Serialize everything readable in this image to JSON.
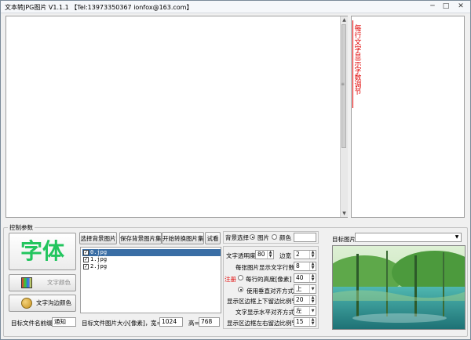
{
  "window": {
    "title": "文本转JPG图片 V1.1.1 【Tel:13973350367  ionfox@163.com】",
    "minimize_glyph": "─",
    "maximize_glyph": "□",
    "close_glyph": "✕"
  },
  "side_hint": {
    "text": "每行文字显示字数调节"
  },
  "control_section": {
    "label": "控制参数"
  },
  "font_button": {
    "label": "字体"
  },
  "text_color_button": {
    "label": "文字颜色"
  },
  "text_outline_button": {
    "label": "文字沟边颜色"
  },
  "prefix": {
    "label": "目标文件名前缀",
    "value": "通知"
  },
  "toolbar": {
    "select_bg": "选择背景图片",
    "save_bg": "保存背景图片集",
    "start_convert": "开始转换图片集",
    "preview": "试看"
  },
  "file_list": {
    "items": [
      {
        "name": "0.jpg",
        "checked": true
      },
      {
        "name": "1.jpg",
        "checked": true
      },
      {
        "name": "2.jpg",
        "checked": true
      }
    ]
  },
  "target_size": {
    "label": "目标文件图片大小[像素]，",
    "width_label": "宽=",
    "width_value": "1024",
    "height_label": "高=",
    "height_value": "768"
  },
  "bg_choice": {
    "label": "背景选择",
    "option_image": "图片",
    "option_color": "颜色",
    "selected": "图片",
    "color_value": ""
  },
  "settings": {
    "transparency_label": "文字透明度",
    "transparency_value": "80",
    "margin_label": "边宽",
    "margin_value": "2",
    "lines_per_image_label": "每张图片显示文字行数",
    "lines_per_image_value": "8",
    "register_label": "注册",
    "row_height_label": "每行的高度[像素]",
    "row_height_value": "40",
    "vertical_align_label": "使用垂直对齐方式",
    "vertical_align_value": "上",
    "top_bottom_ratio_label": "显示区边框上下留边比例%",
    "top_bottom_ratio_value": "20",
    "horizontal_align_label": "文字显示水平对齐方式",
    "horizontal_align_value": "左",
    "left_right_ratio_label": "显示区边框左右留边比例%",
    "left_right_ratio_value": "15"
  },
  "target_image": {
    "label": "目标图片",
    "value": ""
  },
  "colors": {
    "font_button_text": "#22c55e",
    "register_text": "#e00000",
    "side_hint_text": "#e00000"
  },
  "icons": {
    "color_palette": "color-palette-icon",
    "outline_palette": "palette-icon"
  }
}
